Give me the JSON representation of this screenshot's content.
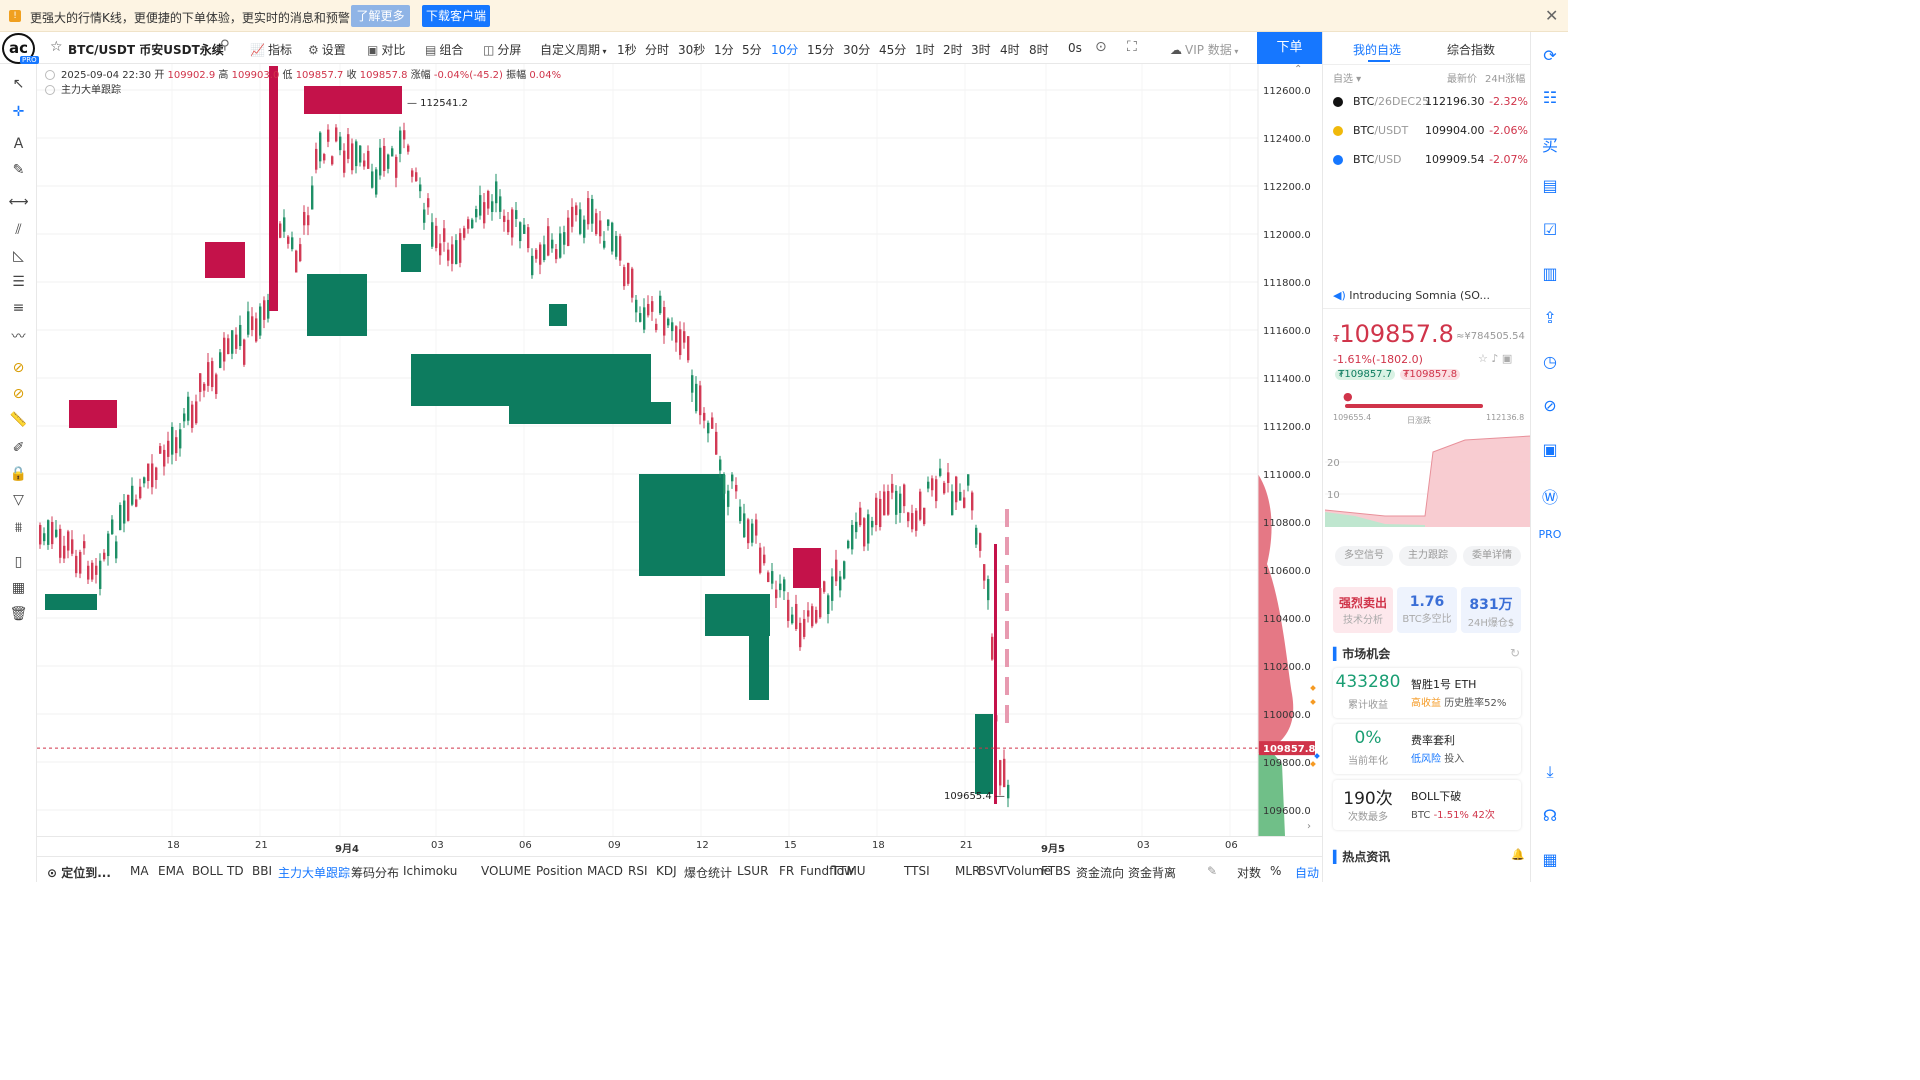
{
  "banner": {
    "message": "更强大的行情K线，更便捷的下单体验，更实时的消息和预警",
    "learn_more": "了解更多",
    "download": "下载客户端",
    "close": "✕"
  },
  "toolbar": {
    "logo": "ac",
    "logo_badge": "PRO",
    "symbol": "BTC/USDT 币安USDT永续",
    "indicator": "指标",
    "settings": "设置",
    "compare": "对比",
    "combine": "组合",
    "split": "分屏",
    "custom_period": "自定义周期",
    "periods": [
      "1秒",
      "分时",
      "30秒",
      "1分",
      "5分",
      "10分",
      "15分",
      "30分",
      "45分",
      "1时",
      "2时",
      "3时",
      "4时",
      "8时",
      "0s"
    ],
    "active_period": "10分",
    "vip": "VIP 数据",
    "order": "下单"
  },
  "chart_info": {
    "datetime": "2025-09-04 22:30",
    "open_label": "开",
    "open": "109902.9",
    "high_label": "高",
    "high": "109903.0",
    "low_label": "低",
    "low": "109857.7",
    "close_label": "收",
    "close": "109857.8",
    "chg_label": "涨幅",
    "chg": "-0.04%(-45.2)",
    "amp_label": "振幅",
    "amp": "0.04%",
    "tracker": "主力大单跟踪"
  },
  "chart_data": {
    "type": "candlestick",
    "price_axis": [
      "112600.0",
      "112400.0",
      "112200.0",
      "112000.0",
      "111800.0",
      "111600.0",
      "111400.0",
      "111200.0",
      "111000.0",
      "110800.0",
      "110600.0",
      "110400.0",
      "110200.0",
      "110000.0",
      "109800.0",
      "109600.0"
    ],
    "ylim": [
      109550,
      112700
    ],
    "x_ticks": [
      "18",
      "21",
      "9月4",
      "03",
      "06",
      "09",
      "12",
      "15",
      "18",
      "21",
      "9月5",
      "03",
      "06"
    ],
    "current_price": "109857.8",
    "annotations": [
      "112541.2",
      "109655.4"
    ],
    "colors": {
      "up": "#0d7c5f",
      "down": "#c4124a",
      "bid": "#e06070",
      "ask": "#4caf6a"
    }
  },
  "bottom": {
    "locate": "定位到...",
    "items": [
      "MA",
      "EMA",
      "BOLL",
      "TD",
      "BBI",
      "主力大单跟踪",
      "筹码分布",
      "Ichimoku",
      "VOLUME",
      "Position",
      "MACD",
      "RSI",
      "KDJ",
      "爆仓统计",
      "LSUR",
      "FR",
      "Fundflow",
      "TTMU",
      "TTSI",
      "MLR",
      "BSV",
      "TVolume",
      "FTBS",
      "资金流向",
      "资金背离"
    ],
    "log": "对数",
    "pct": "%",
    "auto": "自动"
  },
  "right": {
    "tab1": "我的自选",
    "tab2": "综合指数",
    "hdr_watch": "自选",
    "hdr_price": "最新价",
    "hdr_change": "24H涨幅",
    "watchlist": [
      {
        "base": "BTC",
        "quote": "/26DEC25",
        "price": "112196.30",
        "change": "-2.32%"
      },
      {
        "base": "BTC",
        "quote": "/USDT",
        "price": "109904.00",
        "change": "-2.06%"
      },
      {
        "base": "BTC",
        "quote": "/USD",
        "price": "109909.54",
        "change": "-2.07%"
      }
    ],
    "news": "Introducing Somnia (SO...",
    "price": "109857.8",
    "cny": "≈¥784505.54",
    "change": "-1.61%(-1802.0)",
    "bid": "109857.7",
    "ask": "109857.8",
    "low": "109655.4",
    "range_label": "日涨跌",
    "high": "112136.8",
    "y20": "20",
    "y10": "10",
    "signal_tabs": [
      "多空信号",
      "主力跟踪",
      "委单详情"
    ],
    "stats": [
      {
        "v": "强烈卖出",
        "l": "技术分析"
      },
      {
        "v": "1.76",
        "l": "BTC多空比"
      },
      {
        "v": "831万",
        "l": "24H爆仓$"
      }
    ],
    "market_title": "市场机会",
    "opps": [
      {
        "v": "433280",
        "l": "累计收益",
        "t": "智胜1号 ETH",
        "tag": "高收益",
        "d": "历史胜率52%"
      },
      {
        "v": "0%",
        "l": "当前年化",
        "t": "费率套利",
        "tag": "低风险",
        "d": "投入"
      },
      {
        "v": "190次",
        "l": "次数最多",
        "t": "BOLL下破",
        "tag": "BTC",
        "d": "-1.51% 42次"
      }
    ],
    "hot": "热点资讯"
  }
}
